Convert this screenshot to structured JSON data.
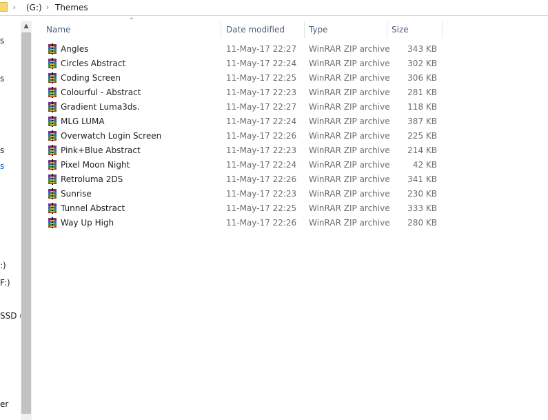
{
  "address_bar": {
    "crumbs": [
      "(G:)",
      "Themes"
    ]
  },
  "nav_pane": {
    "fragments": [
      "s",
      "s",
      "s",
      "s",
      ":)",
      "F:)",
      "SSD (",
      "er"
    ]
  },
  "columns": {
    "name": "Name",
    "date": "Date modified",
    "type": "Type",
    "size": "Size"
  },
  "files": [
    {
      "name": "Angles",
      "date": "11-May-17 22:27",
      "type": "WinRAR ZIP archive",
      "size": "343 KB"
    },
    {
      "name": "Circles Abstract",
      "date": "11-May-17 22:24",
      "type": "WinRAR ZIP archive",
      "size": "302 KB"
    },
    {
      "name": "Coding Screen",
      "date": "11-May-17 22:25",
      "type": "WinRAR ZIP archive",
      "size": "306 KB"
    },
    {
      "name": "Colourful - Abstract",
      "date": "11-May-17 22:23",
      "type": "WinRAR ZIP archive",
      "size": "281 KB"
    },
    {
      "name": "Gradient Luma3ds.",
      "date": "11-May-17 22:27",
      "type": "WinRAR ZIP archive",
      "size": "118 KB"
    },
    {
      "name": "MLG LUMA",
      "date": "11-May-17 22:24",
      "type": "WinRAR ZIP archive",
      "size": "387 KB"
    },
    {
      "name": "Overwatch Login Screen",
      "date": "11-May-17 22:26",
      "type": "WinRAR ZIP archive",
      "size": "225 KB"
    },
    {
      "name": "Pink+Blue Abstract",
      "date": "11-May-17 22:23",
      "type": "WinRAR ZIP archive",
      "size": "214 KB"
    },
    {
      "name": "Pixel Moon Night",
      "date": "11-May-17 22:24",
      "type": "WinRAR ZIP archive",
      "size": "42 KB"
    },
    {
      "name": "Retroluma 2DS",
      "date": "11-May-17 22:26",
      "type": "WinRAR ZIP archive",
      "size": "341 KB"
    },
    {
      "name": "Sunrise",
      "date": "11-May-17 22:23",
      "type": "WinRAR ZIP archive",
      "size": "230 KB"
    },
    {
      "name": "Tunnel Abstract",
      "date": "11-May-17 22:25",
      "type": "WinRAR ZIP archive",
      "size": "333 KB"
    },
    {
      "name": "Way Up High",
      "date": "11-May-17 22:26",
      "type": "WinRAR ZIP archive",
      "size": "280 KB"
    }
  ],
  "icons": {
    "folder": "folder-icon",
    "chevron": "chevron-right-icon",
    "file": "winrar-archive-icon",
    "sort": "sort-ascending-icon",
    "scroll_up": "scroll-up-icon"
  },
  "colors": {
    "header_text": "#4c607a",
    "selection_text": "#0a63c9",
    "secondary_text": "#6d6d6d"
  }
}
